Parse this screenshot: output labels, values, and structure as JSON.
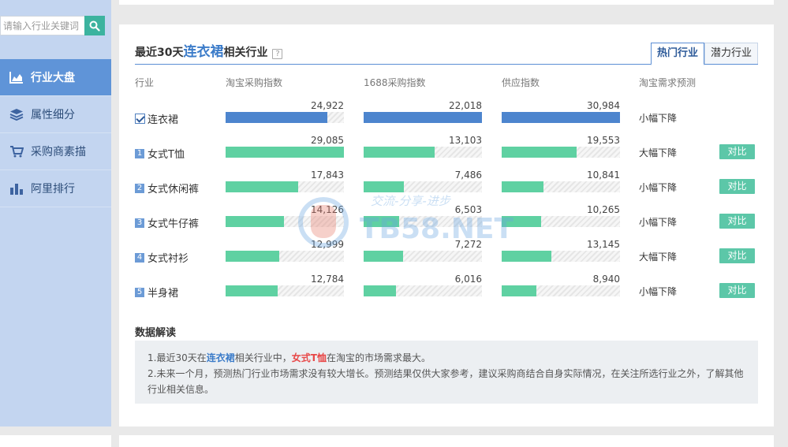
{
  "search": {
    "placeholder": "请输入行业关键词"
  },
  "sidebar": {
    "items": [
      {
        "label": "行业大盘",
        "icon": "area-chart-icon",
        "active": true
      },
      {
        "label": "属性细分",
        "icon": "layers-icon",
        "active": false
      },
      {
        "label": "采购商素描",
        "icon": "cart-icon",
        "active": false
      },
      {
        "label": "阿里排行",
        "icon": "bar-chart-icon",
        "active": false
      }
    ]
  },
  "panel": {
    "title_prefix": "最近30天",
    "title_highlight": "连衣裙",
    "title_suffix": "相关行业",
    "tabs": [
      {
        "label": "热门行业",
        "active": true
      },
      {
        "label": "潜力行业",
        "active": false
      }
    ],
    "columns": [
      "行业",
      "淘宝采购指数",
      "1688采购指数",
      "供应指数",
      "淘宝需求预测"
    ],
    "compare_label": "对比",
    "max_values": {
      "taobao": 30000,
      "ali1688": 24000,
      "supply": 31000
    },
    "rows": [
      {
        "rank": "",
        "checked": true,
        "name": "连衣裙",
        "taobao": "24,922",
        "ali1688": "22,018",
        "supply": "30,984",
        "taobao_frac": 0.86,
        "ali1688_frac": 1.0,
        "supply_frac": 1.0,
        "forecast": "小幅下降",
        "color": "blue",
        "compare": false
      },
      {
        "rank": "1",
        "checked": false,
        "name": "女式T恤",
        "taobao": "29,085",
        "ali1688": "13,103",
        "supply": "19,553",
        "taobao_frac": 1.0,
        "ali1688_frac": 0.6,
        "supply_frac": 0.63,
        "forecast": "大幅下降",
        "color": "green",
        "compare": true
      },
      {
        "rank": "2",
        "checked": false,
        "name": "女式休闲裤",
        "taobao": "17,843",
        "ali1688": "7,486",
        "supply": "10,841",
        "taobao_frac": 0.61,
        "ali1688_frac": 0.34,
        "supply_frac": 0.35,
        "forecast": "小幅下降",
        "color": "green",
        "compare": true
      },
      {
        "rank": "3",
        "checked": false,
        "name": "女式牛仔裤",
        "taobao": "14,126",
        "ali1688": "6,503",
        "supply": "10,265",
        "taobao_frac": 0.49,
        "ali1688_frac": 0.3,
        "supply_frac": 0.33,
        "forecast": "小幅下降",
        "color": "green",
        "compare": true
      },
      {
        "rank": "4",
        "checked": false,
        "name": "女式衬衫",
        "taobao": "12,999",
        "ali1688": "7,272",
        "supply": "13,145",
        "taobao_frac": 0.45,
        "ali1688_frac": 0.33,
        "supply_frac": 0.42,
        "forecast": "大幅下降",
        "color": "green",
        "compare": true
      },
      {
        "rank": "5",
        "checked": false,
        "name": "半身裙",
        "taobao": "12,784",
        "ali1688": "6,016",
        "supply": "8,940",
        "taobao_frac": 0.44,
        "ali1688_frac": 0.27,
        "supply_frac": 0.29,
        "forecast": "小幅下降",
        "color": "green",
        "compare": true
      }
    ]
  },
  "interpretation": {
    "title": "数据解读",
    "line1_a": "1.最近30天在",
    "line1_hl1": "连衣裙",
    "line1_b": "相关行业中，",
    "line1_hl2": "女式T恤",
    "line1_c": "在淘宝的市场需求最大。",
    "line2": "2.未来一个月，预测热门行业市场需求没有较大增长。预测结果仅供大家参考，建议采购商结合自身实际情况，在关注所选行业之外，了解其他行业相关信息。"
  },
  "watermark": {
    "top_text": "交流-分享-进步",
    "big_text": "TB58.NET"
  },
  "colors": {
    "accent": "#5f94d8",
    "bar_blue": "#4d85ce",
    "bar_green": "#5fd1a2",
    "compare_btn": "#5cc7a8",
    "search_btn": "#3cb39f"
  }
}
